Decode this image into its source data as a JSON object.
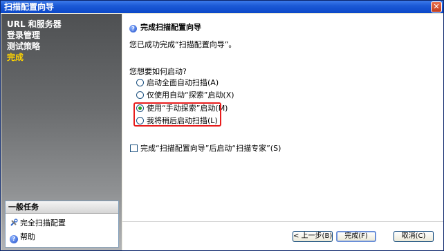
{
  "window": {
    "title": "扫描配置向导",
    "close_glyph": "✕"
  },
  "sidebar": {
    "items": [
      {
        "label": "URL 和服务器",
        "active": false
      },
      {
        "label": "登录管理",
        "active": false
      },
      {
        "label": "测试策略",
        "active": false
      },
      {
        "label": "完成",
        "active": true
      }
    ],
    "tasks": {
      "header": "一般任务",
      "links": [
        {
          "label": "完全扫描配置",
          "icon": "tools-icon"
        },
        {
          "label": "帮助",
          "icon": "help-icon"
        }
      ]
    }
  },
  "main": {
    "title": "完成扫描配置向导",
    "intro": "您已成功完成“扫描配置向导”。",
    "question": "您想要如何启动?",
    "options": [
      {
        "label": "启动全面自动扫描(A)",
        "checked": false
      },
      {
        "label": "仅使用自动“探索”启动(X)",
        "checked": false
      },
      {
        "label": "使用“手动探索”启动(M)",
        "checked": true
      },
      {
        "label": "我将稍后启动扫描(L)",
        "checked": false
      }
    ],
    "checkbox": {
      "label": "完成“扫描配置向导”后启动“扫描专家”(S)",
      "checked": false
    }
  },
  "buttons": {
    "back": "< 上一步(B)",
    "finish": "完成(F)",
    "cancel": "取消(C)"
  },
  "colors": {
    "titlebar": "#0b47c8",
    "active_nav": "#ffd400",
    "highlight": "#e81c1c",
    "radio_dot": "#21a121"
  }
}
